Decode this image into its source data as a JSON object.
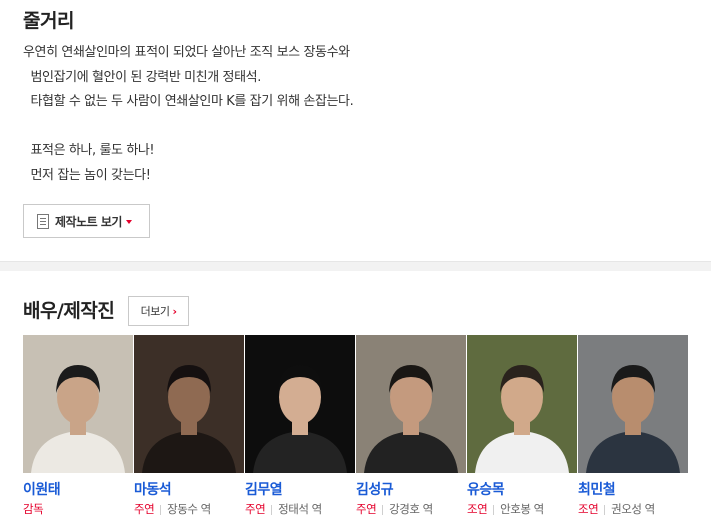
{
  "synopsis": {
    "title": "줄거리",
    "lines": [
      "우연히 연쇄살인마의 표적이 되었다 살아난 조직 보스 장동수와",
      "  범인잡기에 혈안이 된 강력반 미친개 정태석.",
      "  타협할 수 없는 두 사람이 연쇄살인마 K를 잡기 위해 손잡는다.",
      "",
      "  표적은 하나, 룰도 하나!",
      "  먼저 잡는 놈이 갖는다!"
    ],
    "note_button_label": "제작노트 보기"
  },
  "cast": {
    "title": "배우/제작진",
    "more_label": "더보기",
    "people": [
      {
        "name": "이원태",
        "type": "감독",
        "character": "",
        "bg": "#c7c0b4",
        "skin": "#c9a488",
        "hair": "#1b1b1b",
        "clothes": "#ece9e3"
      },
      {
        "name": "마동석",
        "type": "주연",
        "character": "장동수 역",
        "bg": "#3c2f27",
        "skin": "#8f6a52",
        "hair": "#151010",
        "clothes": "#1d1714"
      },
      {
        "name": "김무열",
        "type": "주연",
        "character": "정태석 역",
        "bg": "#0d0d0d",
        "skin": "#d3ad92",
        "hair": "#0e0e0e",
        "clothes": "#232323"
      },
      {
        "name": "김성규",
        "type": "주연",
        "character": "강경호 역",
        "bg": "#8a8276",
        "skin": "#c49a7e",
        "hair": "#1a1714",
        "clothes": "#222222"
      },
      {
        "name": "유승목",
        "type": "조연",
        "character": "안호봉 역",
        "bg": "#5f6b3f",
        "skin": "#d1a98a",
        "hair": "#2a231d",
        "clothes": "#f0f0f0"
      },
      {
        "name": "최민철",
        "type": "조연",
        "character": "권오성 역",
        "bg": "#7b7d7f",
        "skin": "#b88d6e",
        "hair": "#1a1a1a",
        "clothes": "#2b3440"
      }
    ]
  }
}
